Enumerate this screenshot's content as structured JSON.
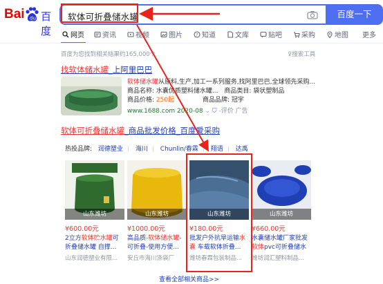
{
  "logo": {
    "bai": "Bai",
    "du": "du",
    "cn": "百度"
  },
  "search": {
    "query": "软体可折叠储水罐",
    "button": "百度一下"
  },
  "tabs": [
    {
      "label": "网页",
      "icon": "search-icon"
    },
    {
      "label": "资讯",
      "icon": "news-icon"
    },
    {
      "label": "视频",
      "icon": "video-icon"
    },
    {
      "label": "图片",
      "icon": "image-icon"
    },
    {
      "label": "知道",
      "icon": "question-icon"
    },
    {
      "label": "文库",
      "icon": "doc-icon"
    },
    {
      "label": "贴吧",
      "icon": "forum-icon"
    },
    {
      "label": "采购",
      "icon": "purchase-icon"
    },
    {
      "label": "地图",
      "icon": "map-icon"
    },
    {
      "label": "更多",
      "icon": ""
    }
  ],
  "result_count": "百度为您找到相关结果约165,000个",
  "tools": "搜索工具",
  "result1": {
    "title_hl": "找软体储水罐",
    "title_rest": "_上阿里巴巴",
    "line1_hl": "软体储水罐",
    "line1_rest": "从原料,生产,加工一系列服务,找阿里巴巴,全球领先采购...",
    "name_key": "商品名称:",
    "name_val": "水囊优质塑料储水罐...",
    "cat_key": "商品类目:",
    "cat_val": "袋状塑制品",
    "price_key": "商品价格:",
    "price_val": "250起",
    "brand_key": "商品品牌:",
    "brand_val": "冠宇",
    "url": "www.1688.com",
    "date": "2020-08",
    "eval": "评价",
    "ad": "广告"
  },
  "result2": {
    "title_hl": "软体可折叠储水罐",
    "title_rest": "_商品批发价格_百度爱采购",
    "hot_label": "热投品牌:",
    "brands": [
      "润德塑业",
      "海川",
      "Chunlin/春霖",
      "翔语",
      "达禹"
    ],
    "more": "查看全部相关商品>>"
  },
  "products": [
    {
      "location": "山东潍坊",
      "price": "¥600.00元",
      "desc_pre": "2立方",
      "desc_hl": "软体贮水罐",
      "desc_post": "可折叠储水罐 自撑...",
      "seller": "山东润德塑业有限...",
      "img_color": "#2f6b2e"
    },
    {
      "location": "山东潍坊",
      "price": "¥1000.00元",
      "desc_pre": "高品质-",
      "desc_hl": "软体储水罐",
      "desc_post": "-可折叠-使用方便...",
      "seller": "安丘市海川涤袋厂",
      "img_color": "#e8b80c"
    },
    {
      "location": "山东潍坊",
      "price": "¥180.00元",
      "desc_pre": "批发户外抗旱运输",
      "desc_hl": "水囊",
      "desc_post": " 车载软体折叠...",
      "seller": "潍坊春霖包装制品...",
      "img_color": "#3d5a7a"
    },
    {
      "location": "山东潍坊",
      "price": "¥660.00元",
      "desc_pre": "水囊储水罐厂家批发 ",
      "desc_hl": "软体",
      "desc_post": "pvc可折叠储水罐 ...",
      "seller": "潍坊润汇塑料制品...",
      "img_color": "#1f3fb5"
    }
  ],
  "colors": {
    "accent": "#4e6ef2",
    "highlight": "#f73131",
    "link": "#2440b3",
    "annotation": "#e8231c"
  }
}
